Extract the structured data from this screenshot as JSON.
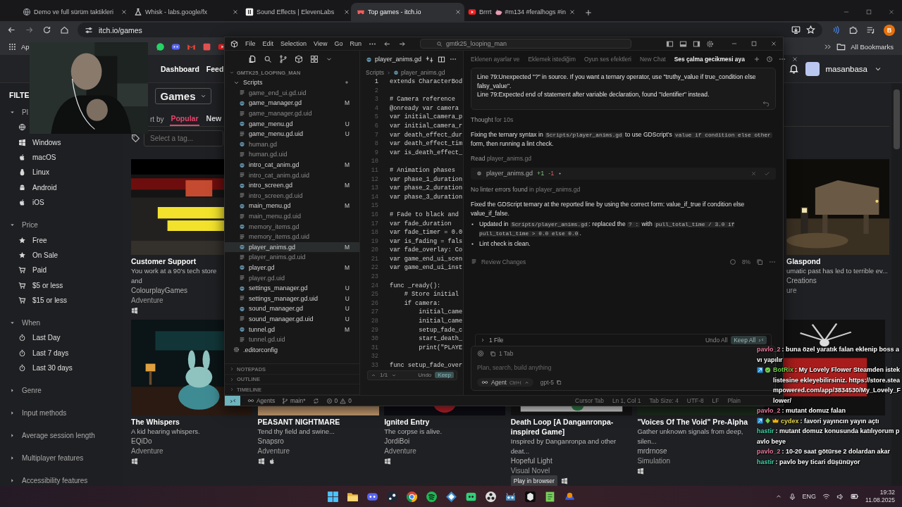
{
  "browser": {
    "tabs": [
      {
        "title": "Demo ve full sürüm taktikleri",
        "selected": false
      },
      {
        "title": "Whisk - labs.google/fx",
        "selected": false
      },
      {
        "title": "Sound Effects | ElevenLabs",
        "selected": false
      },
      {
        "title": "Top games - itch.io",
        "selected": true
      },
      {
        "title": "Brrrt",
        "suffix": "#m134 #feralhogs #in",
        "selected": false
      }
    ],
    "address": "itch.io/games",
    "profile": "B",
    "apps_label": "Ap",
    "all_bookmarks": "All Bookmarks"
  },
  "itch": {
    "nav": [
      "Dashboard",
      "Feed"
    ],
    "user": "masanbasa",
    "filters_title": "FILTE",
    "filter_groups": [
      {
        "label": "Pl",
        "expanded": true,
        "items": [
          {
            "kind": "web"
          },
          {
            "kind": "windows",
            "label": "Windows"
          },
          {
            "kind": "apple",
            "label": "macOS"
          },
          {
            "kind": "linux",
            "label": "Linux"
          },
          {
            "kind": "android",
            "label": "Android"
          },
          {
            "kind": "apple",
            "label": "iOS"
          }
        ]
      },
      {
        "label": "Price",
        "expanded": true,
        "items": [
          {
            "kind": "star",
            "label": "Free"
          },
          {
            "kind": "star",
            "label": "On Sale"
          },
          {
            "kind": "cart",
            "label": "Paid"
          },
          {
            "kind": "cart",
            "label": "$5 or less"
          },
          {
            "kind": "cart",
            "label": "$15 or less"
          }
        ]
      },
      {
        "label": "When",
        "expanded": true,
        "items": [
          {
            "kind": "timer",
            "label": "Last Day"
          },
          {
            "kind": "timer",
            "label": "Last 7 days"
          },
          {
            "kind": "timer",
            "label": "Last 30 days"
          }
        ]
      },
      {
        "label": "Genre",
        "expanded": false
      },
      {
        "label": "Input methods",
        "expanded": false
      },
      {
        "label": "Average session length",
        "expanded": false
      },
      {
        "label": "Multiplayer features",
        "expanded": false
      },
      {
        "label": "Accessibility features",
        "expanded": false
      }
    ],
    "games_button": "Games",
    "sort_label": "rt by",
    "sort_tabs": [
      {
        "label": "Popular",
        "selected": true
      },
      {
        "label": "New",
        "selected": false
      }
    ],
    "tag_placeholder": "Select a tag...",
    "featured": [
      {
        "title": "Customer Support",
        "description": "You work at a 90's tech store and",
        "author": "ColourplayGames",
        "genre": "Adventure",
        "windows": true,
        "macos": false
      },
      {
        "title": "Glaspond",
        "description": "umatic past has led to terrible ev...",
        "author": "Creations",
        "genre": "ure",
        "windows": false,
        "macos": false
      }
    ],
    "games": [
      {
        "kind": "game",
        "title": "The Whispers",
        "description": "A kid hearing whispers.",
        "author": "EQiDo",
        "genre": "Adventure",
        "windows": true,
        "macos": false
      },
      {
        "kind": "game",
        "title": "PEASANT NIGHTMARE",
        "description": "Tend thy field and swine...",
        "author": "Snapsro",
        "genre": "Adventure",
        "windows": true,
        "macos": true
      },
      {
        "kind": "game",
        "title": "Ignited Entry",
        "description": "The corpse is alive.",
        "author": "JordiBoi",
        "genre": "Adventure",
        "windows": true,
        "macos": false
      },
      {
        "kind": "game",
        "title": "Death Loop [A Danganronpa-inspired Game]",
        "description": "Inspired by Danganronpa and other deat...",
        "author": "Hopeful Light",
        "genre": "Visual Novel",
        "badge": "Play in browser",
        "windows": true,
        "macos": false
      },
      {
        "kind": "game",
        "title": "\"Voices Of The Void\" Pre-Alpha",
        "description": "Gather unknown signals from deep, silen...",
        "author": "mrdrnose",
        "genre": "Simulation",
        "windows": true,
        "macos": false
      },
      {
        "kind": "picture"
      }
    ]
  },
  "editor": {
    "menu": [
      "File",
      "Edit",
      "Selection",
      "View",
      "Go",
      "Run"
    ],
    "search": "gmtk25_looping_man",
    "project": "GMTK25_LOOPING_MAN",
    "tree": [
      {
        "kind": "folder",
        "name": "Scripts",
        "expanded": true,
        "modified": true,
        "children": [
          {
            "kind": "uid",
            "name": "game_end_ui.gd.uid",
            "dimmed": true,
            "selected": false
          },
          {
            "kind": "gd",
            "name": "game_manager.gd",
            "status": "M",
            "dimmed": false,
            "selected": false
          },
          {
            "kind": "uid",
            "name": "game_manager.gd.uid",
            "dimmed": true,
            "selected": false
          },
          {
            "kind": "gd",
            "name": "game_menu.gd",
            "status": "U",
            "dimmed": false,
            "selected": false
          },
          {
            "kind": "uid",
            "name": "game_menu.gd.uid",
            "status": "U",
            "dimmed": false,
            "selected": false
          },
          {
            "kind": "gd",
            "name": "human.gd",
            "dimmed": true,
            "selected": false
          },
          {
            "kind": "uid",
            "name": "human.gd.uid",
            "dimmed": true,
            "selected": false
          },
          {
            "kind": "gd",
            "name": "intro_cat_anim.gd",
            "status": "M",
            "dimmed": false,
            "selected": false
          },
          {
            "kind": "uid",
            "name": "intro_cat_anim.gd.uid",
            "dimmed": true,
            "selected": false
          },
          {
            "kind": "gd",
            "name": "intro_screen.gd",
            "status": "M",
            "dimmed": false,
            "selected": false
          },
          {
            "kind": "uid",
            "name": "intro_screen.gd.uid",
            "dimmed": true,
            "selected": false
          },
          {
            "kind": "gd",
            "name": "main_menu.gd",
            "status": "M",
            "dimmed": false,
            "selected": false
          },
          {
            "kind": "uid",
            "name": "main_menu.gd.uid",
            "dimmed": true,
            "selected": false
          },
          {
            "kind": "gd",
            "name": "memory_items.gd",
            "dimmed": true,
            "selected": false
          },
          {
            "kind": "uid",
            "name": "memory_items.gd.uid",
            "dimmed": true,
            "selected": false
          },
          {
            "kind": "gd",
            "name": "player_anims.gd",
            "status": "M",
            "dimmed": false,
            "selected": true
          },
          {
            "kind": "uid",
            "name": "player_anims.gd.uid",
            "dimmed": true,
            "selected": false
          },
          {
            "kind": "gd",
            "name": "player.gd",
            "status": "M",
            "dimmed": false,
            "selected": false
          },
          {
            "kind": "uid",
            "name": "player.gd.uid",
            "dimmed": true,
            "selected": false
          },
          {
            "kind": "gd",
            "name": "settings_manager.gd",
            "status": "U",
            "dimmed": false,
            "selected": false
          },
          {
            "kind": "uid",
            "name": "settings_manager.gd.uid",
            "status": "U",
            "dimmed": false,
            "selected": false
          },
          {
            "kind": "gd",
            "name": "sound_manager.gd",
            "status": "U",
            "dimmed": false,
            "selected": false
          },
          {
            "kind": "uid",
            "name": "sound_manager.gd.uid",
            "status": "U",
            "dimmed": false,
            "selected": false
          },
          {
            "kind": "gd",
            "name": "tunnel.gd",
            "status": "M",
            "dimmed": false,
            "selected": false
          },
          {
            "kind": "uid",
            "name": "tunnel.gd.uid",
            "dimmed": true,
            "selected": false
          }
        ]
      },
      {
        "kind": "config",
        "name": ".editorconfig",
        "dimmed": false,
        "selected": false
      }
    ],
    "sections": [
      "NOTEPADS",
      "OUTLINE",
      "TIMELINE"
    ],
    "tab": "player_anims.gd",
    "breadcrumb": [
      "Scripts",
      "player_anims.gd"
    ],
    "code": [
      {
        "number": "1",
        "text": "extends CharacterBod",
        "current": true
      },
      {
        "number": "2",
        "current": false
      },
      {
        "number": "3",
        "text": "# Camera reference",
        "current": false
      },
      {
        "number": "4",
        "text": "@onready var camera",
        "current": false
      },
      {
        "number": "5",
        "text": "var initial_camera_p",
        "current": false
      },
      {
        "number": "6",
        "text": "var initial_camera_r",
        "current": false
      },
      {
        "number": "7",
        "text": "var death_effect_dur",
        "current": false
      },
      {
        "number": "8",
        "text": "var death_effect_tim",
        "current": false
      },
      {
        "number": "9",
        "text": "var is_death_effect_",
        "current": false
      },
      {
        "number": "10",
        "current": false
      },
      {
        "number": "11",
        "text": "# Animation phases",
        "current": false
      },
      {
        "number": "12",
        "text": "var phase_1_duration",
        "current": false
      },
      {
        "number": "13",
        "text": "var phase_2_duration",
        "current": false
      },
      {
        "number": "14",
        "text": "var phase_3_duration",
        "current": false
      },
      {
        "number": "15",
        "current": false
      },
      {
        "number": "16",
        "text": "# Fade to black and",
        "current": false
      },
      {
        "number": "17",
        "text": "var fade_duration",
        "current": false
      },
      {
        "number": "18",
        "text": "var fade_timer = 0.0",
        "current": false
      },
      {
        "number": "19",
        "text": "var is_fading = fals",
        "current": false
      },
      {
        "number": "20",
        "text": "var fade_overlay: Co",
        "current": false
      },
      {
        "number": "21",
        "text": "var game_end_ui_scen",
        "current": false
      },
      {
        "number": "22",
        "text": "var game_end_ui_inst",
        "current": false
      },
      {
        "number": "23",
        "current": false
      },
      {
        "number": "24",
        "text": "func _ready():",
        "current": false
      },
      {
        "number": "25",
        "text": "    # Store initial",
        "current": false
      },
      {
        "number": "26",
        "text": "    if camera:",
        "current": false
      },
      {
        "number": "27",
        "text": "        initial_came",
        "current": false
      },
      {
        "number": "28",
        "text": "        initial_came",
        "current": false
      },
      {
        "number": "29",
        "text": "        setup_fade_c",
        "current": false
      },
      {
        "number": "30",
        "text": "        start_death_",
        "current": false
      },
      {
        "number": "31",
        "text": "        print(\"PLAYE",
        "current": false
      },
      {
        "number": "32",
        "current": false
      },
      {
        "number": "33",
        "text": "func setup_fade_over",
        "current": false
      }
    ],
    "diff_nav": {
      "count": "1/1",
      "undo": "Undo",
      "keep": "Keep"
    },
    "chat_tabs": [
      {
        "label": "Eklenen ayarlar ve",
        "selected": false
      },
      {
        "label": "Eklemek istediğim",
        "selected": false
      },
      {
        "label": "Oyun ses efektleri",
        "selected": false
      },
      {
        "label": "New Chat",
        "selected": false
      },
      {
        "label": "Ses çalma gecikmesi aya",
        "selected": true
      }
    ],
    "error_message": [
      "Line 79:Unexpected \"?\" in source. If you want a ternary operator, use \"truthy_value if true_condition else falsy_value\".",
      "Line 79:Expected end of statement after variable declaration, found \"Identifier\" instead."
    ],
    "reply": [
      {
        "kind": "status",
        "label": "Thought",
        "detail": "for 10s"
      },
      {
        "kind": "paragraph",
        "segments": [
          {
            "text": "Fixing the ternary syntax in ",
            "code": false
          },
          {
            "text": "Scripts/player_anims.gd",
            "code": true
          },
          {
            "text": " to use GDScript's ",
            "code": false
          },
          {
            "text": "value if condition else other",
            "code": true
          },
          {
            "text": " form, then running a lint check.",
            "code": false
          }
        ]
      },
      {
        "kind": "status",
        "label": "Read",
        "detail": "player_anims.gd"
      },
      {
        "kind": "file",
        "name": "player_anims.gd",
        "added": "+1",
        "removed": "-1"
      },
      {
        "kind": "status",
        "label": "No linter errors found",
        "detail": "in player_anims.gd"
      },
      {
        "kind": "paragraph",
        "segments": [
          {
            "text": "Fixed the GDScript ternary at the reported line by using the correct form: value_if_true if condition else value_if_false.",
            "code": false
          }
        ]
      },
      {
        "kind": "bullet",
        "segments": [
          {
            "text": "Updated in ",
            "code": false
          },
          {
            "text": "Scripts/player_anims.gd",
            "code": true
          },
          {
            "text": ": replaced the ",
            "code": false
          },
          {
            "text": "? :",
            "code": true
          },
          {
            "text": " with ",
            "code": false
          },
          {
            "text": "pull_total_time / 3.0 if pull_total_time > 0.0 else 0.0",
            "code": true
          },
          {
            "text": ".",
            "code": false
          }
        ]
      },
      {
        "kind": "bullet",
        "segments": [
          {
            "text": "Lint check is clean.",
            "code": false
          }
        ]
      }
    ],
    "review": {
      "label": "Review Changes",
      "usage": "8%"
    },
    "changes": {
      "files": "1 File",
      "undo_all": "Undo All",
      "keep_all": "Keep All"
    },
    "composer": {
      "context": "1 Tab",
      "placeholder": "Plan, search, build anything",
      "mode": "Agent",
      "shortcut": "Ctrl+I",
      "model": "gpt-5"
    },
    "status_bar": {
      "agents": "Agents",
      "branch": "main*",
      "errors": "0",
      "warnings": "0",
      "right": [
        "Cursor Tab",
        "Ln 1, Col 1",
        "Tab Size: 4",
        "UTF-8",
        "LF",
        "Plain"
      ]
    }
  },
  "chat": [
    {
      "user": "pavlo_2",
      "color": "#e8799e",
      "bot": false,
      "verified": false,
      "gem": false,
      "crown": false,
      "text": ": buna özel yaratık falan eklenip boss avı yapılır"
    },
    {
      "user": "BotRix",
      "color": "#6fd14a",
      "bot": true,
      "verified": true,
      "gem": false,
      "crown": false,
      "text": ": My Lovely Flower Steamden istek listesine ekleyebilirsiniz. https://store.steampowered.com/app/3834530/My_Lovely_Flower/"
    },
    {
      "user": "pavlo_2",
      "color": "#e8799e",
      "bot": false,
      "verified": false,
      "gem": false,
      "crown": false,
      "text": ": mutant domuz falan"
    },
    {
      "user": "cydex",
      "color": "#e7d94a",
      "bot": true,
      "verified": false,
      "gem": true,
      "crown": true,
      "text": ": favori yayıncın yayın açtı"
    },
    {
      "user": "hastir",
      "color": "#3fd6a8",
      "bot": false,
      "verified": false,
      "gem": false,
      "crown": false,
      "text": ": mutant domuz konusunda katılıyorum pavlo beye"
    },
    {
      "user": "pavlo_2",
      "color": "#e8799e",
      "bot": false,
      "verified": false,
      "gem": false,
      "crown": false,
      "text": ": 10-20 saat götürse 2 dolardan akar"
    },
    {
      "user": "hastir",
      "color": "#3fd6a8",
      "bot": false,
      "verified": false,
      "gem": false,
      "crown": false,
      "text": ": pavlo bey ticari düşünüyor"
    }
  ],
  "taskbar": {
    "language": "ENG",
    "time": "19:32",
    "date": "11.08.2025"
  }
}
